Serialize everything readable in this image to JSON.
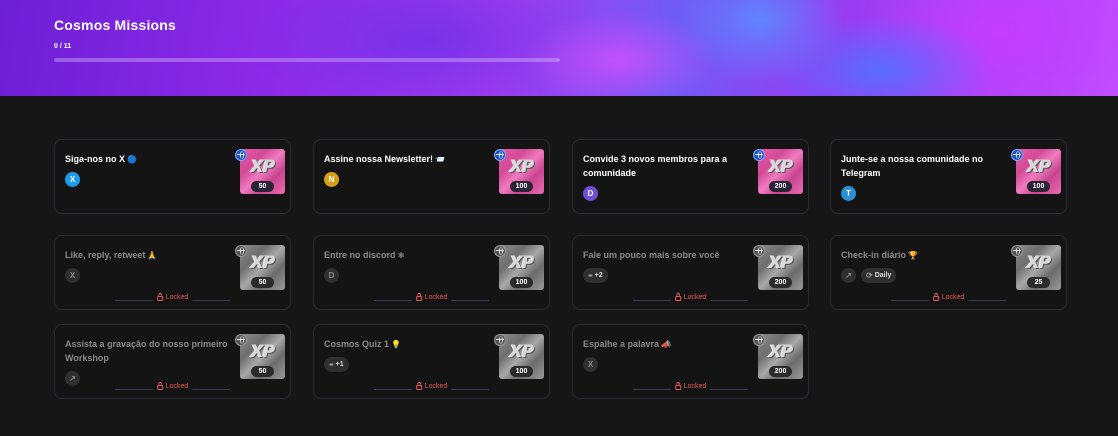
{
  "header": {
    "title": "Cosmos Missions",
    "progress": "0 / 11",
    "progress_fraction": 0
  },
  "missions": [
    {
      "title": "Siga-nos no X",
      "emoji": "🔵",
      "social": "X",
      "social_icon": "twitter-icon",
      "social_color": "#1d9bf0",
      "xp": "50",
      "locked": false
    },
    {
      "title": "Assine nossa Newsletter!",
      "emoji": "📨",
      "social": "N",
      "social_icon": "newsletter-icon",
      "social_color": "#d4a017",
      "xp": "100",
      "locked": false
    },
    {
      "title": "Convide 3 novos membros para a comunidade",
      "emoji": "",
      "social": "D",
      "social_icon": "discord-icon",
      "social_color": "#6b4fd8",
      "xp": "200",
      "locked": false
    },
    {
      "title": "Junte-se a nossa comunidade no Telegram",
      "emoji": "",
      "social": "T",
      "social_icon": "telegram-icon",
      "social_color": "#2a8fd6",
      "xp": "100",
      "locked": false
    },
    {
      "title": "Like, reply, retweet",
      "emoji": "🙏",
      "social": "X",
      "social_icon": "twitter-icon",
      "xp": "50",
      "locked": true
    },
    {
      "title": "Entre no discord",
      "emoji": "⚛",
      "social": "D",
      "social_icon": "discord-icon",
      "xp": "100",
      "locked": true
    },
    {
      "title": "Fale um pouco mais sobre você",
      "emoji": "",
      "pill": "+2",
      "xp": "200",
      "locked": true
    },
    {
      "title": "Check-in diário",
      "emoji": "🏆",
      "social": "↗",
      "social_icon": "external-link-icon",
      "pill": "Daily",
      "xp": "25",
      "locked": true
    },
    {
      "title": "Assista a gravação do nosso primeiro Workshop",
      "emoji": "",
      "social": "↗",
      "social_icon": "external-link-icon",
      "xp": "50",
      "locked": true
    },
    {
      "title": "Cosmos Quiz 1",
      "emoji": "💡",
      "pill": "+1",
      "xp": "100",
      "locked": true
    },
    {
      "title": "Espalhe a palavra",
      "emoji": "📣",
      "social": "X",
      "social_icon": "twitter-icon",
      "xp": "200",
      "locked": true
    }
  ],
  "locked_label": "Locked",
  "xp_label": "XP"
}
